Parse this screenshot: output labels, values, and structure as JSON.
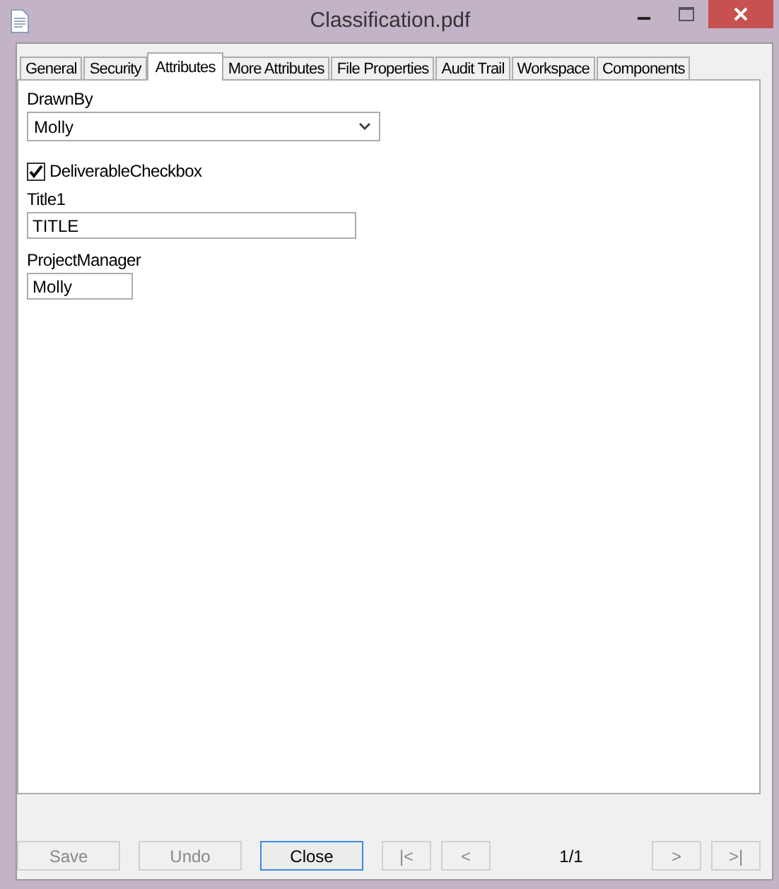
{
  "window": {
    "title": "Classification.pdf"
  },
  "tabs": [
    {
      "label": "General",
      "selected": false
    },
    {
      "label": "Security",
      "selected": false
    },
    {
      "label": "Attributes",
      "selected": true
    },
    {
      "label": "More Attributes",
      "selected": false
    },
    {
      "label": "File Properties",
      "selected": false
    },
    {
      "label": "Audit Trail",
      "selected": false
    },
    {
      "label": "Workspace",
      "selected": false
    },
    {
      "label": "Components",
      "selected": false
    }
  ],
  "fields": [
    {
      "kind": "dropdown",
      "label": "DrawnBy",
      "value": "Molly"
    },
    {
      "kind": "checkbox",
      "label": "DeliverableCheckbox",
      "checked": true
    },
    {
      "kind": "textfield",
      "label": "Title1",
      "value": "TITLE"
    },
    {
      "kind": "shortfield",
      "label": "ProjectManager",
      "value": "Molly"
    }
  ],
  "buttons": [
    {
      "label": "Save",
      "disabled": true
    },
    {
      "label": "Undo",
      "disabled": true
    },
    {
      "label": "Close",
      "disabled": false
    }
  ],
  "navigation": [
    {
      "label": "|<",
      "disabled": true
    },
    {
      "label": "<",
      "disabled": true
    },
    {
      "kind": "counter",
      "label": "1/1"
    },
    {
      "label": ">",
      "disabled": true
    },
    {
      "label": ">|",
      "disabled": true
    }
  ]
}
